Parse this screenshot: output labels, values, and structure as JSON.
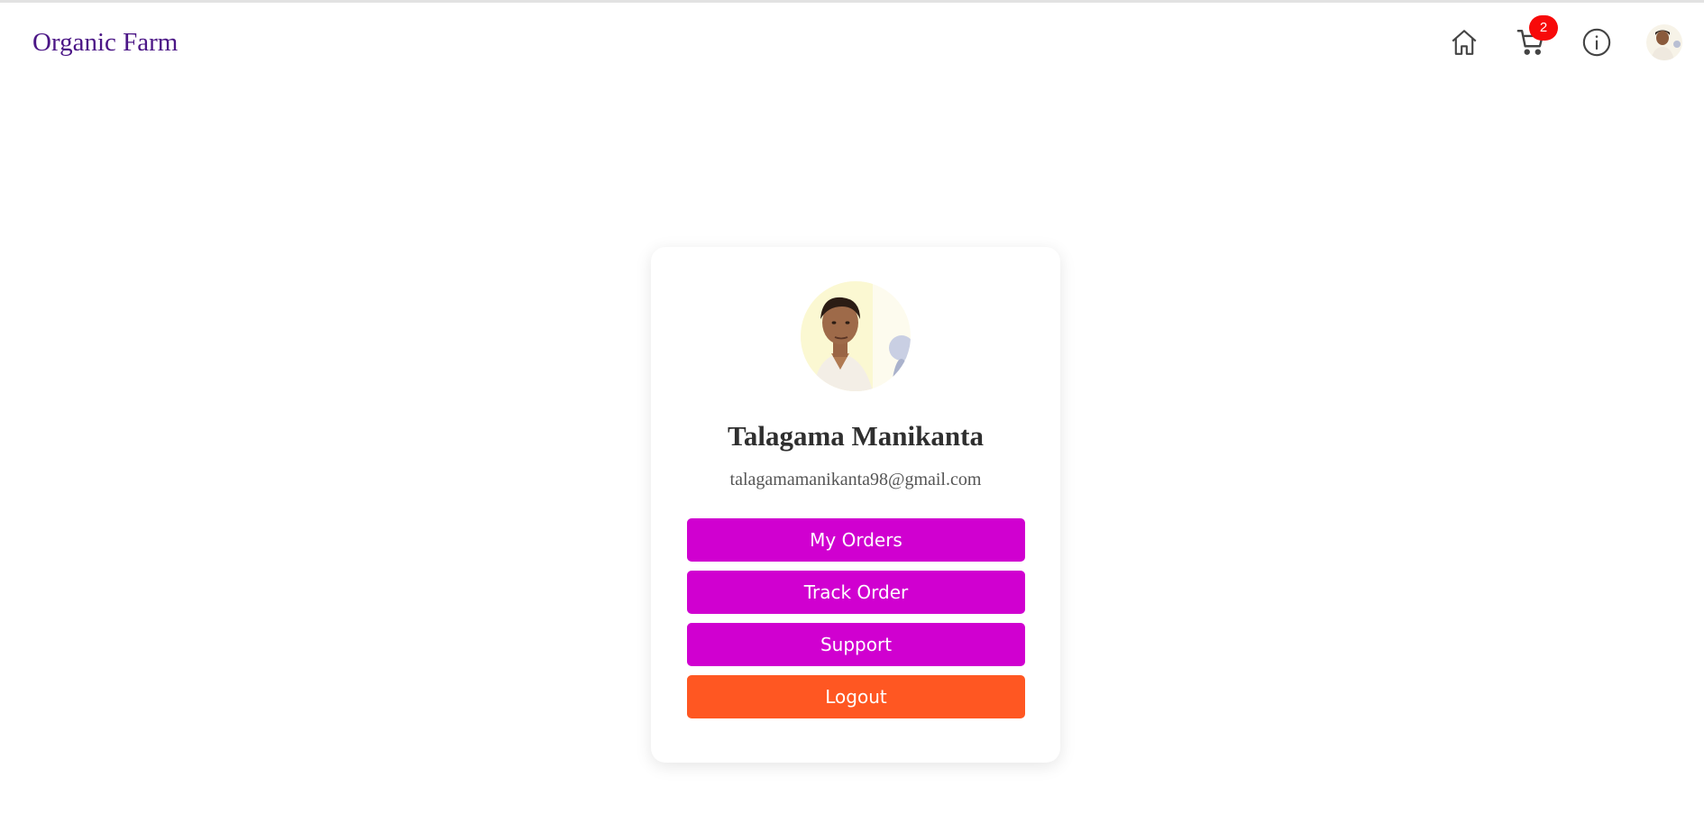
{
  "navbar": {
    "brand": "Organic Farm",
    "icons": {
      "home": "home-icon",
      "cart": "cart-icon",
      "info": "info-icon"
    },
    "cart_count": "2",
    "avatar": "user-avatar"
  },
  "profile": {
    "name": "Talagama Manikanta",
    "email": "talagamamanikanta98@gmail.com",
    "actions": {
      "my_orders": "My Orders",
      "track_order": "Track Order",
      "support": "Support",
      "logout": "Logout"
    }
  },
  "colors": {
    "brand_text": "#4b1686",
    "primary_button": "#d000d0",
    "logout_button": "#ff5722",
    "badge": "#f70a0a"
  }
}
